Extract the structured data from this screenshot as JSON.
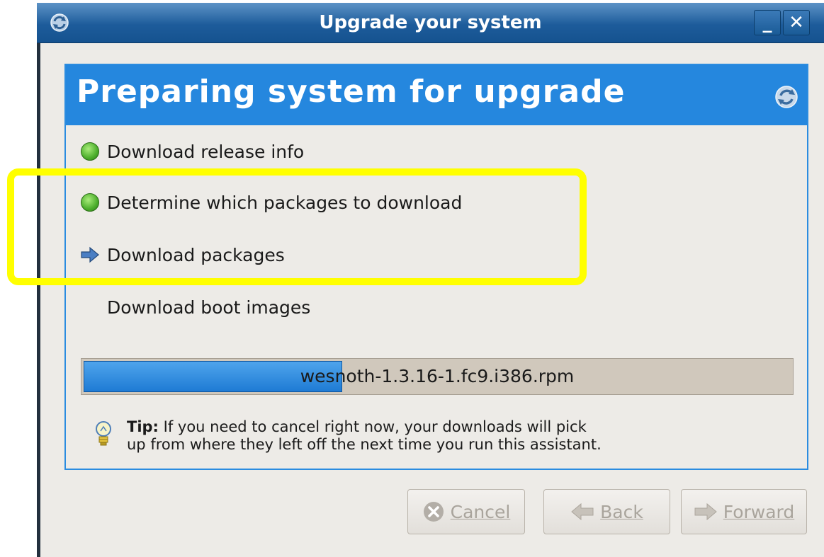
{
  "window": {
    "title": "Upgrade your system",
    "minimize_label": "_",
    "close_label": "✕"
  },
  "panel": {
    "heading": "Preparing system for upgrade"
  },
  "steps": [
    {
      "label": "Download release info",
      "status": "done"
    },
    {
      "label": "Determine which packages to download",
      "status": "done"
    },
    {
      "label": "Download packages",
      "status": "in-progress"
    },
    {
      "label": "Download boot images",
      "status": "pending"
    }
  ],
  "progress": {
    "text": "wesnoth-1.3.16-1.fc9.i386.rpm",
    "fraction": 0.37
  },
  "tip": {
    "label": "Tip:",
    "text_line1": " If you need to cancel right now, your downloads will pick",
    "text_line2": "up from where they left off the next time you run this assistant."
  },
  "buttons": {
    "cancel": "Cancel",
    "back": "Back",
    "forward": "Forward"
  },
  "colors": {
    "accent": "#2587de",
    "highlight": "#ffff00",
    "status_done": "#4cae2c"
  }
}
